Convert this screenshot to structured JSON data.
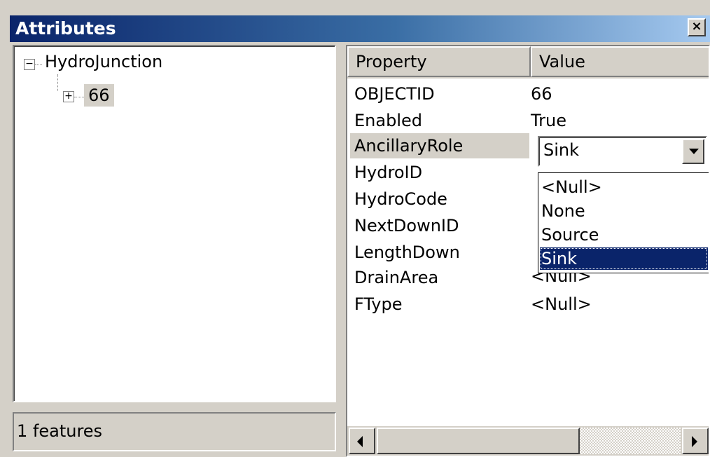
{
  "window": {
    "title": "Attributes",
    "close_glyph": "×"
  },
  "tree": {
    "root": {
      "label": "HydroJunction",
      "expander": "−",
      "icon": "minus-expander-icon"
    },
    "child": {
      "label": "66",
      "expander": "+",
      "icon": "plus-expander-icon"
    }
  },
  "status": {
    "text": "1 features"
  },
  "grid": {
    "columns": {
      "property": "Property",
      "value": "Value"
    },
    "rows": [
      {
        "name": "OBJECTID",
        "value": "66"
      },
      {
        "name": "Enabled",
        "value": "True"
      },
      {
        "name": "AncillaryRole",
        "value": ""
      },
      {
        "name": "HydroID",
        "value": ""
      },
      {
        "name": "HydroCode",
        "value": ""
      },
      {
        "name": "NextDownID",
        "value": ""
      },
      {
        "name": "LengthDown",
        "value": ""
      },
      {
        "name": "DrainArea",
        "value": "<Null>"
      },
      {
        "name": "FType",
        "value": "<Null>"
      }
    ],
    "combo": {
      "selected": "Sink",
      "options": [
        "<Null>",
        "None",
        "Source",
        "Sink"
      ],
      "highlighted_index": 3
    }
  },
  "colors": {
    "title_gradient_start": "#0a246a",
    "title_gradient_end": "#a6caf0",
    "selection": "#0a246a",
    "face": "#d4d0c8"
  }
}
